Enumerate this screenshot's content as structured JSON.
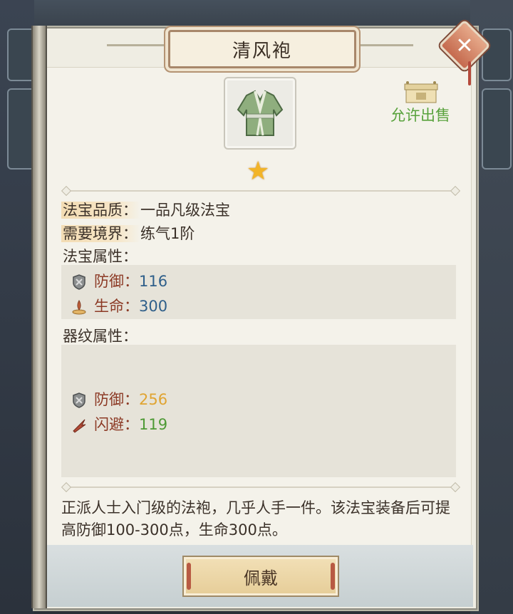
{
  "item": {
    "name": "清风袍",
    "quality_label": "法宝品质：",
    "quality_value": "一品凡级法宝",
    "realm_label": "需要境界：",
    "realm_value": "练气1阶",
    "allow_sale": "允许出售",
    "star_count": 1,
    "description": "正派人士入门级的法袍，几乎人手一件。该法宝装备后可提高防御100-300点，生命300点。"
  },
  "attributes": {
    "title": "法宝属性：",
    "stats": [
      {
        "label": "防御：",
        "value": "116",
        "icon": "shield-icon",
        "color": "#2f5f8a"
      },
      {
        "label": "生命：",
        "value": "300",
        "icon": "life-flame-icon",
        "color": "#2f5f8a"
      }
    ]
  },
  "inscription": {
    "title": "器纹属性：",
    "stats": [
      {
        "label": "防御：",
        "value": "256",
        "icon": "shield-icon",
        "color": "#e0a432"
      },
      {
        "label": "闪避：",
        "value": "119",
        "icon": "dodge-icon",
        "color": "#4e9a35"
      }
    ]
  },
  "actions": {
    "wear": "佩戴",
    "close_icon": "close-icon"
  }
}
